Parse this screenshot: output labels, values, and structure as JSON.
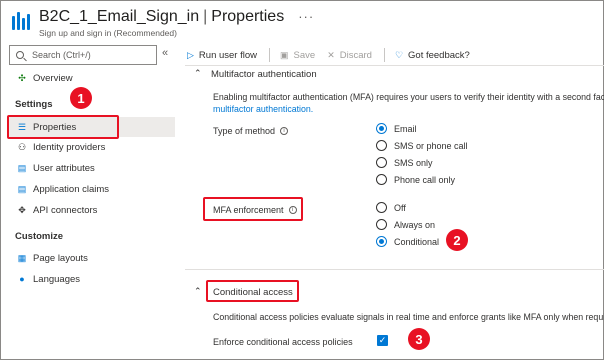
{
  "header": {
    "title": "B2C_1_Email_Sign_in",
    "separator": "|",
    "section": "Properties",
    "more": "···",
    "subtitle": "Sign up and sign in (Recommended)"
  },
  "sidebar": {
    "search_placeholder": "Search (Ctrl+/)",
    "collapse": "«",
    "overview": "Overview",
    "settings_header": "Settings",
    "settings_items": [
      {
        "label": "Properties"
      },
      {
        "label": "Identity providers"
      },
      {
        "label": "User attributes"
      },
      {
        "label": "Application claims"
      },
      {
        "label": "API connectors"
      }
    ],
    "customize_header": "Customize",
    "customize_items": [
      {
        "label": "Page layouts"
      },
      {
        "label": "Languages"
      }
    ]
  },
  "toolbar": {
    "run": "Run user flow",
    "save": "Save",
    "discard": "Discard",
    "feedback": "Got feedback?"
  },
  "mfa_section": {
    "title": "Multifactor authentication",
    "desc": "Enabling multifactor authentication (MFA) requires your users to verify their identity with a second factor",
    "link": "multifactor authentication.",
    "type_label": "Type of method",
    "type_options": [
      "Email",
      "SMS or phone call",
      "SMS only",
      "Phone call only"
    ],
    "type_selected": "Email",
    "enforcement_label": "MFA enforcement",
    "enforcement_options": [
      "Off",
      "Always on",
      "Conditional"
    ],
    "enforcement_selected": "Conditional"
  },
  "ca_section": {
    "title": "Conditional access",
    "desc": "Conditional access policies evaluate signals in real time and enforce grants like MFA only when required.",
    "enforce_label": "Enforce conditional access policies",
    "enforce_checked": true
  },
  "callouts": [
    "1",
    "2",
    "3"
  ],
  "colors": {
    "accent": "#0078d4",
    "callout": "#e81123"
  }
}
